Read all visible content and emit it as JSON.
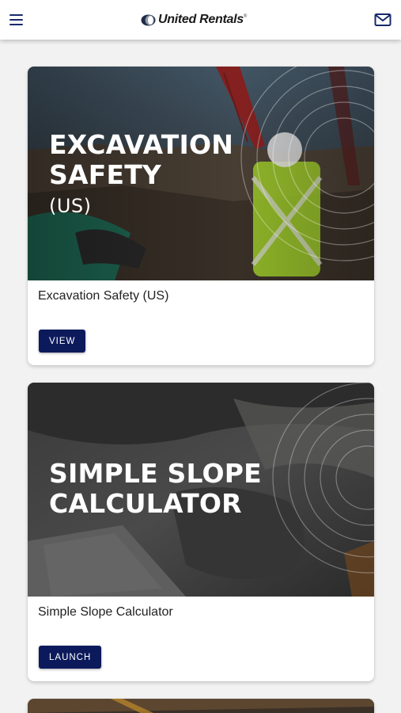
{
  "header": {
    "brand": "United Rentals",
    "brand_mark": "®",
    "menu_icon": "hamburger-menu-icon",
    "mail_icon": "mail-icon"
  },
  "cards": [
    {
      "hero_title": "EXCAVATION\nSAFETY",
      "hero_subtitle": "(US)",
      "title": "Excavation Safety (US)",
      "button": "VIEW"
    },
    {
      "hero_title": "SIMPLE SLOPE\nCALCULATOR",
      "title": "Simple Slope Calculator",
      "button": "LAUNCH"
    }
  ],
  "colors": {
    "accent": "#0c1a5c",
    "header_icons": "#17296b",
    "background": "#f2f2f2"
  }
}
